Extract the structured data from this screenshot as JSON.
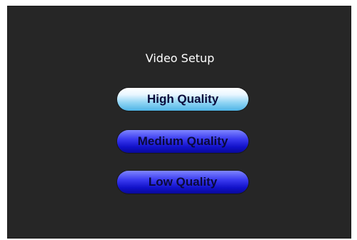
{
  "menu": {
    "title": "Video Setup",
    "options": [
      {
        "label": "High Quality",
        "state": "selected"
      },
      {
        "label": "Medium Quality",
        "state": "normal"
      },
      {
        "label": "Low Quality",
        "state": "normal"
      }
    ]
  },
  "colors": {
    "screen_background": "#262626",
    "title_text": "#ffffff",
    "selected_button": "#8fd4f4",
    "normal_button": "#1a1ad8",
    "button_text": "#0a0a3a"
  }
}
